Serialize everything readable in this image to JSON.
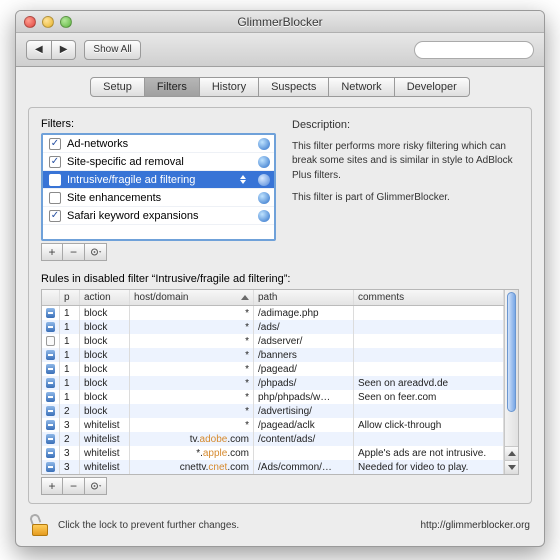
{
  "window": {
    "title": "GlimmerBlocker"
  },
  "toolbar": {
    "showall": "Show All",
    "search_placeholder": ""
  },
  "tabs": [
    "Setup",
    "Filters",
    "History",
    "Suspects",
    "Network",
    "Developer"
  ],
  "active_tab_index": 1,
  "filters": {
    "label": "Filters:",
    "items": [
      {
        "checked": true,
        "name": "Ad-networks",
        "selected": false
      },
      {
        "checked": true,
        "name": "Site-specific ad removal",
        "selected": false
      },
      {
        "checked": false,
        "name": "Intrusive/fragile ad filtering",
        "selected": true
      },
      {
        "checked": false,
        "name": "Site enhancements",
        "selected": false
      },
      {
        "checked": true,
        "name": "Safari keyword expansions",
        "selected": false
      }
    ],
    "add": "+",
    "remove": "−",
    "gear": "✻"
  },
  "description": {
    "label": "Description:",
    "p1": "This filter performs more risky filtering which can break some sites and is similar in style to AdBlock Plus filters.",
    "p2": "This filter is part of GlimmerBlocker."
  },
  "rules": {
    "label": "Rules in disabled filter “Intrusive/fragile ad filtering”:",
    "columns": {
      "p": "p",
      "action": "action",
      "host": "host/domain",
      "path": "path",
      "comments": "comments"
    },
    "rows": [
      {
        "icon": "minus",
        "p": "1",
        "action": "block",
        "host": "*",
        "path": "/adimage.php",
        "comments": ""
      },
      {
        "icon": "minus",
        "p": "1",
        "action": "block",
        "host": "*",
        "path": "/ads/",
        "comments": ""
      },
      {
        "icon": "empty",
        "p": "1",
        "action": "block",
        "host": "*",
        "path": "/adserver/",
        "comments": ""
      },
      {
        "icon": "minus",
        "p": "1",
        "action": "block",
        "host": "*",
        "path": "/banners",
        "comments": ""
      },
      {
        "icon": "minus",
        "p": "1",
        "action": "block",
        "host": "*",
        "path": "/pagead/",
        "comments": ""
      },
      {
        "icon": "minus",
        "p": "1",
        "action": "block",
        "host": "*",
        "path": "/phpads/",
        "comments": "Seen on areadvd.de"
      },
      {
        "icon": "minus",
        "p": "1",
        "action": "block",
        "host": "*",
        "path": "php/phpads/w…",
        "comments": "Seen on feer.com"
      },
      {
        "icon": "minus",
        "p": "2",
        "action": "block",
        "host": "*",
        "path": "/advertising/",
        "comments": ""
      },
      {
        "icon": "minus",
        "p": "3",
        "action": "whitelist",
        "host": "*",
        "path": "/pagead/aclk",
        "comments": "Allow click-through"
      },
      {
        "icon": "minus",
        "p": "2",
        "action": "whitelist",
        "host_pre": "tv.",
        "host_hi": "adobe",
        "host_post": ".com",
        "path": "/content/ads/",
        "comments": ""
      },
      {
        "icon": "minus",
        "p": "3",
        "action": "whitelist",
        "host_pre": "*.",
        "host_hi": "apple",
        "host_post": ".com",
        "path": "",
        "comments": "Apple's ads are not intrusive."
      },
      {
        "icon": "minus",
        "p": "3",
        "action": "whitelist",
        "host_pre": "cnettv.",
        "host_hi": "cnet",
        "host_post": ".com",
        "path": "/Ads/common/…",
        "comments": "Needed for video to play."
      }
    ]
  },
  "footer": {
    "lock_text": "Click the lock to prevent further changes.",
    "url": "http://glimmerblocker.org"
  }
}
